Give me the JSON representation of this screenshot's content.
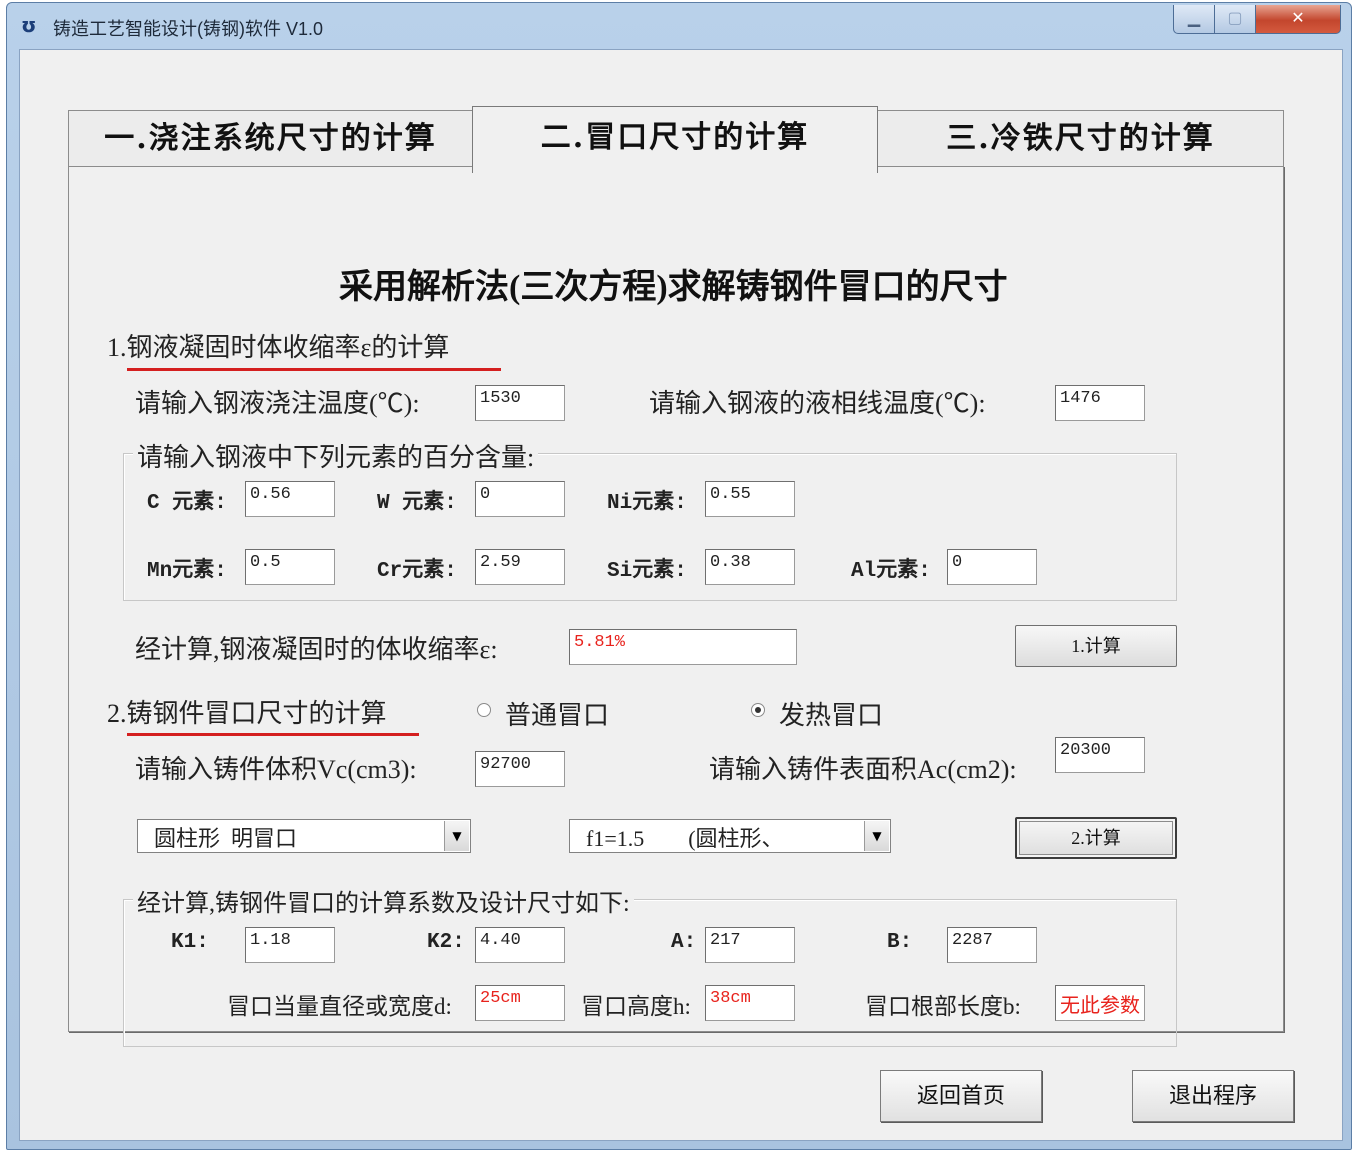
{
  "window": {
    "icon": "app-logo-icon",
    "title": "铸造工艺智能设计(铸钢)软件 V1.0"
  },
  "tabs": [
    "一.浇注系统尺寸的计算",
    "二.冒口尺寸的计算",
    "三.冷铁尺寸的计算"
  ],
  "panel": {
    "heading": "采用解析法(三次方程)求解铸钢件冒口的尺寸",
    "section1": {
      "title": "1.钢液凝固时体收缩率ε的计算",
      "pour_temp_label": "请输入钢液浇注温度(℃):",
      "pour_temp_value": "1530",
      "liquidus_label": "请输入钢液的液相线温度(℃):",
      "liquidus_value": "1476",
      "elements_group_title": "请输入钢液中下列元素的百分含量:",
      "elements": [
        {
          "label": "C 元素:",
          "value": "0.56"
        },
        {
          "label": "W 元素:",
          "value": "0"
        },
        {
          "label": "Ni元素:",
          "value": "0.55"
        },
        {
          "label": "Mn元素:",
          "value": "0.5"
        },
        {
          "label": "Cr元素:",
          "value": "2.59"
        },
        {
          "label": "Si元素:",
          "value": "0.38"
        },
        {
          "label": "Al元素:",
          "value": "0"
        }
      ],
      "result_label": "经计算,钢液凝固时的体收缩率ε:",
      "result_value": "5.81%",
      "calc_button": "1.计算"
    },
    "section2": {
      "title": "2.铸钢件冒口尺寸的计算",
      "radio_normal": "普通冒口",
      "radio_heating": "发热冒口",
      "selected_riser": "发热冒口",
      "volume_label": "请输入铸件体积Vc(cm3):",
      "volume_value": "92700",
      "area_label": "请输入铸件表面积Ac(cm2):",
      "area_value": "20300",
      "riser_type_select": "圆柱形  明冒口",
      "f1_select": "f1=1.5        (圆柱形、",
      "calc_button": "2.计算",
      "results_group_title": "经计算,铸钢件冒口的计算系数及设计尺寸如下:",
      "k1_label": "K1:",
      "k1_value": "1.18",
      "k2_label": "K2:",
      "k2_value": "4.40",
      "a_label": "A:",
      "a_value": "217",
      "b_label": "B:",
      "b_value": "2287",
      "d_label": "冒口当量直径或宽度d:",
      "d_value": "25cm",
      "h_label": "冒口高度h:",
      "h_value": "38cm",
      "root_label": "冒口根部长度b:",
      "root_value": "无此参数"
    }
  },
  "footer": {
    "home_button": "返回首页",
    "exit_button": "退出程序"
  },
  "colors": {
    "result_red": "#e8231d",
    "underline_red": "#d41f1f",
    "titlebar": "#b9d1ea"
  }
}
